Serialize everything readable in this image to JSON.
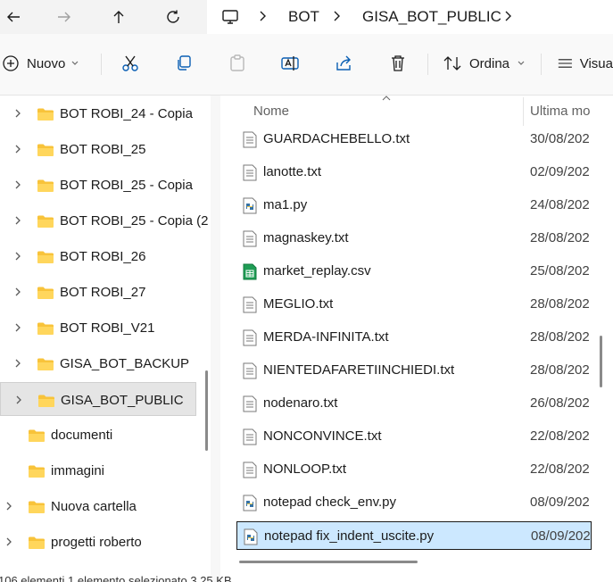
{
  "nav_buttons": {
    "back": "back-arrow-icon",
    "forward": "forward-arrow-icon",
    "up": "up-arrow-icon",
    "refresh": "refresh-icon"
  },
  "breadcrumb": {
    "items": [
      "BOT",
      "GISA_BOT_PUBLIC"
    ]
  },
  "toolbar": {
    "new_label": "Nuovo",
    "sort_label": "Ordina",
    "view_label": "Visua"
  },
  "sidebar": {
    "items": [
      {
        "label": "BOT ROBI_24 - Copia",
        "expandable": true
      },
      {
        "label": "BOT ROBI_25",
        "expandable": true
      },
      {
        "label": "BOT ROBI_25 - Copia",
        "expandable": true
      },
      {
        "label": "BOT ROBI_25 - Copia (2",
        "expandable": true
      },
      {
        "label": "BOT ROBI_26",
        "expandable": true
      },
      {
        "label": "BOT ROBI_27",
        "expandable": true
      },
      {
        "label": "BOT ROBI_V21",
        "expandable": true
      },
      {
        "label": "GISA_BOT_BACKUP",
        "expandable": true
      },
      {
        "label": "GISA_BOT_PUBLIC",
        "expandable": true,
        "selected": true
      },
      {
        "label": "documenti",
        "expandable": false
      },
      {
        "label": "immagini",
        "expandable": false
      },
      {
        "label": "Nuova cartella",
        "expandable": true
      },
      {
        "label": "progetti roberto",
        "expandable": true
      }
    ]
  },
  "file_list": {
    "columns": [
      "Nome",
      "Ultima mo"
    ],
    "rows": [
      {
        "name": "GUARDACHEBELLO.txt",
        "date": "30/08/202",
        "type": "txt"
      },
      {
        "name": "lanotte.txt",
        "date": "02/09/202",
        "type": "txt"
      },
      {
        "name": "ma1.py",
        "date": "24/08/202",
        "type": "py"
      },
      {
        "name": "magnaskey.txt",
        "date": "28/08/202",
        "type": "txt"
      },
      {
        "name": "market_replay.csv",
        "date": "25/08/202",
        "type": "csv"
      },
      {
        "name": "MEGLIO.txt",
        "date": "28/08/202",
        "type": "txt"
      },
      {
        "name": "MERDA-INFINITA.txt",
        "date": "28/08/202",
        "type": "txt"
      },
      {
        "name": "NIENTEDAFARETIINCHIEDI.txt",
        "date": "28/08/202",
        "type": "txt"
      },
      {
        "name": "nodenaro.txt",
        "date": "26/08/202",
        "type": "txt"
      },
      {
        "name": "NONCONVINCE.txt",
        "date": "22/08/202",
        "type": "txt"
      },
      {
        "name": "NONLOOP.txt",
        "date": "22/08/202",
        "type": "txt"
      },
      {
        "name": "notepad check_env.py",
        "date": "08/09/202",
        "type": "py"
      },
      {
        "name": "notepad fix_indent_uscite.py",
        "date": "08/09/202",
        "type": "py",
        "selected": true
      }
    ]
  },
  "status_bar": {
    "text": "106 elementi   1 elemento selezionato  3,25 KB"
  },
  "colors": {
    "accent": "#0067c0",
    "selection": "#cce8ff",
    "folder": "#f8c33a"
  }
}
